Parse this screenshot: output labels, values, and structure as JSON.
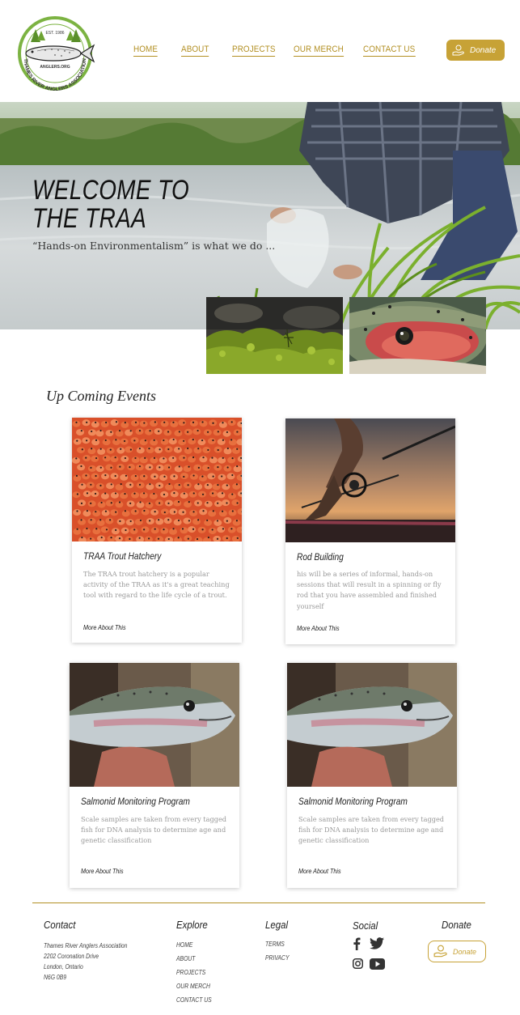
{
  "logo": {
    "est": "EST. 1986",
    "url": "ANGLERS.ORG",
    "org": "THAMES RIVER ANGLERS ASSOCIATION"
  },
  "nav": {
    "home": "HOME",
    "about": "ABOUT",
    "projects": "PROJECTS",
    "merch": "OUR MERCH",
    "contact": "CONTACT US"
  },
  "header": {
    "donate": "Donate"
  },
  "hero": {
    "title_line1": "WELCOME TO",
    "title_line2": "THE TRAA",
    "subtitle": "“Hands-on Environmentalism” is what we do ..."
  },
  "events": {
    "title": "Up Coming Events",
    "items": [
      {
        "title": "TRAA Trout Hatchery",
        "desc": "The TRAA trout hatchery is a popular activity of the TRAA as it's a great teaching tool with regard to the life cycle of a trout.",
        "more": "More About This"
      },
      {
        "title": "Rod Building",
        "desc": "his will be a series of informal, hands-on sessions that will result in a spinning or fly rod that you have assembled and finished yourself",
        "more": "More About This"
      },
      {
        "title": "Salmonid Monitoring Program",
        "desc": "Scale samples are taken from every tagged fish for DNA analysis to determine age and genetic classification",
        "more": "More About This"
      },
      {
        "title": "Salmonid Monitoring Program",
        "desc": "Scale samples are taken from every tagged fish for DNA analysis to determine age and genetic classification",
        "more": "More About This"
      }
    ]
  },
  "footer": {
    "contact": {
      "title": "Contact",
      "lines": [
        "Thames River Anglers Association",
        "2202 Coronation Drive",
        "London, Ontario",
        "N6G 0B9"
      ]
    },
    "explore": {
      "title": "Explore",
      "links": [
        "HOME",
        "ABOUT",
        "PROJECTS",
        "OUR MERCH",
        "CONTACT US"
      ]
    },
    "legal": {
      "title": "Legal",
      "links": [
        "TERMS",
        "PRIVACY"
      ]
    },
    "social": {
      "title": "Social",
      "icons": [
        "facebook-icon",
        "twitter-icon",
        "instagram-icon",
        "youtube-icon"
      ]
    },
    "donate": {
      "title": "Donate",
      "button": "Donate"
    }
  },
  "colors": {
    "gold": "#c7a236",
    "nav_gold": "#b39024",
    "logo_green": "#7cb342"
  }
}
